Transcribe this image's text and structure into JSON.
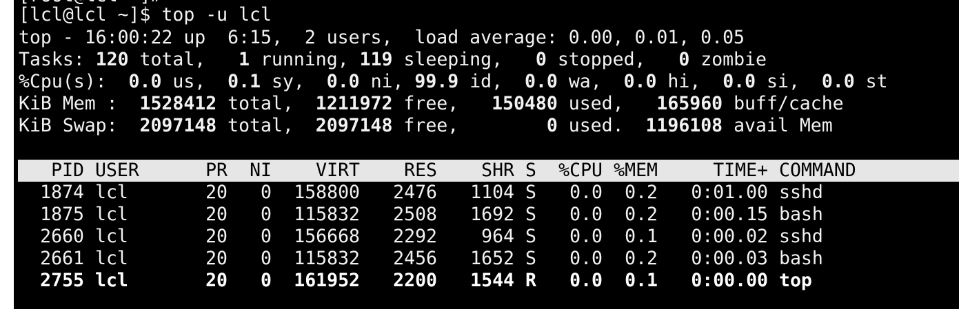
{
  "clipped_top_line": "[root@lcl ~]#",
  "prompt": {
    "text": "[lcl@lcl ~]$ top -u lcl"
  },
  "summary": {
    "line1": "top - 16:00:22 up  6:15,  2 users,  load average: 0.00, 0.01, 0.05",
    "tasks": {
      "label": "Tasks: ",
      "total": "120",
      "total_lbl": " total,   ",
      "running": "1",
      "running_lbl": " running, ",
      "sleeping": "119",
      "sleeping_lbl": " sleeping,   ",
      "stopped": "0",
      "stopped_lbl": " stopped,   ",
      "zombie": "0",
      "zombie_lbl": " zombie"
    },
    "cpu": {
      "label": "%Cpu(s):  ",
      "us": "0.0",
      "us_lbl": " us,  ",
      "sy": "0.1",
      "sy_lbl": " sy,  ",
      "ni": "0.0",
      "ni_lbl": " ni, ",
      "id": "99.9",
      "id_lbl": " id,  ",
      "wa": "0.0",
      "wa_lbl": " wa,  ",
      "hi": "0.0",
      "hi_lbl": " hi,  ",
      "si": "0.0",
      "si_lbl": " si,  ",
      "st": "0.0",
      "st_lbl": " st"
    },
    "mem": {
      "label": "KiB Mem :  ",
      "total": "1528412",
      "total_lbl": " total,  ",
      "free": "1211972",
      "free_lbl": " free,   ",
      "used": "150480",
      "used_lbl": " used,   ",
      "buff": "165960",
      "buff_lbl": " buff/cache"
    },
    "swap": {
      "label": "KiB Swap:  ",
      "total": "2097148",
      "total_lbl": " total,  ",
      "free": "2097148",
      "free_lbl": " free,        ",
      "used": "0",
      "used_lbl": " used.  ",
      "avail": "1196108",
      "avail_lbl": " avail Mem"
    }
  },
  "table": {
    "headers": {
      "pid": "PID",
      "user": "USER",
      "pr": "PR",
      "ni": "NI",
      "virt": "VIRT",
      "res": "RES",
      "shr": "SHR",
      "s": "S",
      "cpu": "%CPU",
      "mem": "%MEM",
      "time": "TIME+",
      "command": "COMMAND"
    },
    "rows": [
      {
        "pid": "1874",
        "user": "lcl",
        "pr": "20",
        "ni": "0",
        "virt": "158800",
        "res": "2476",
        "shr": "1104",
        "s": "S",
        "cpu": "0.0",
        "mem": "0.2",
        "time": "0:01.00",
        "command": "sshd",
        "bold": false
      },
      {
        "pid": "1875",
        "user": "lcl",
        "pr": "20",
        "ni": "0",
        "virt": "115832",
        "res": "2508",
        "shr": "1692",
        "s": "S",
        "cpu": "0.0",
        "mem": "0.2",
        "time": "0:00.15",
        "command": "bash",
        "bold": false
      },
      {
        "pid": "2660",
        "user": "lcl",
        "pr": "20",
        "ni": "0",
        "virt": "156668",
        "res": "2292",
        "shr": "964",
        "s": "S",
        "cpu": "0.0",
        "mem": "0.1",
        "time": "0:00.02",
        "command": "sshd",
        "bold": false
      },
      {
        "pid": "2661",
        "user": "lcl",
        "pr": "20",
        "ni": "0",
        "virt": "115832",
        "res": "2456",
        "shr": "1652",
        "s": "S",
        "cpu": "0.0",
        "mem": "0.2",
        "time": "0:00.03",
        "command": "bash",
        "bold": false
      },
      {
        "pid": "2755",
        "user": "lcl",
        "pr": "20",
        "ni": "0",
        "virt": "161952",
        "res": "2200",
        "shr": "1544",
        "s": "R",
        "cpu": "0.0",
        "mem": "0.1",
        "time": "0:00.00",
        "command": "top",
        "bold": true
      }
    ]
  },
  "colors": {
    "background": "#000000",
    "foreground": "#f2f2f2",
    "header_bar": "#e6e6e6",
    "header_text": "#000000"
  }
}
